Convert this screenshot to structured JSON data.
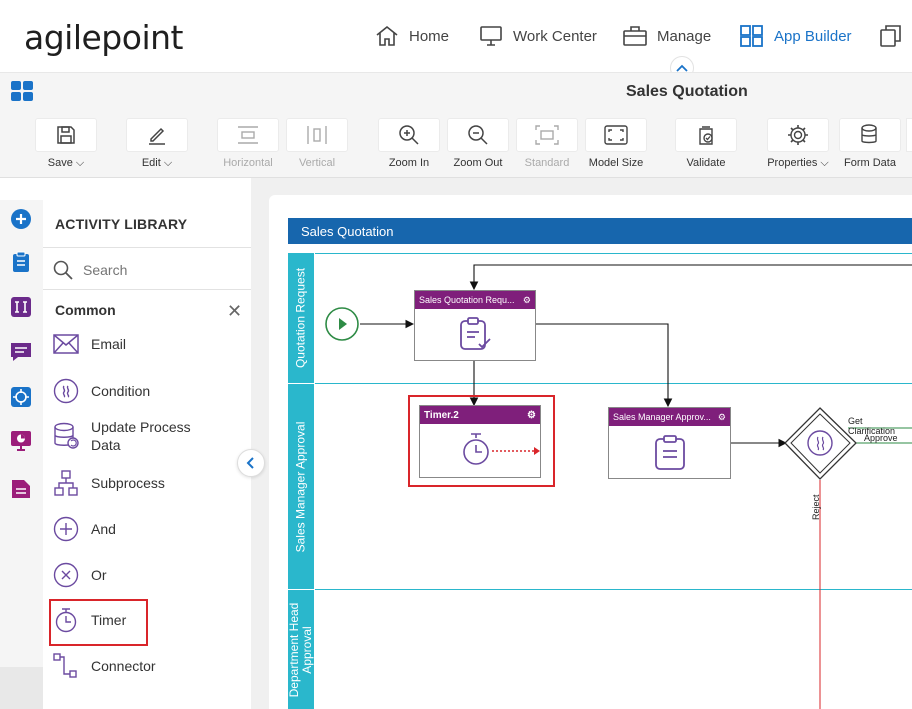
{
  "brand": {
    "logo_text": "agilepoint"
  },
  "nav": {
    "items": [
      {
        "label": "Home",
        "icon": "home-icon"
      },
      {
        "label": "Work Center",
        "icon": "monitor-icon"
      },
      {
        "label": "Manage",
        "icon": "briefcase-icon"
      },
      {
        "label": "App Builder",
        "icon": "grid-icon",
        "active": true
      },
      {
        "label": "",
        "icon": "copy-icon"
      }
    ]
  },
  "title_bar": {
    "title": "Sales Quotation"
  },
  "toolbar": {
    "save": "Save",
    "edit": "Edit",
    "horizontal": "Horizontal",
    "vertical": "Vertical",
    "zoom_in": "Zoom In",
    "zoom_out": "Zoom Out",
    "standard": "Standard",
    "model_size": "Model Size",
    "validate": "Validate",
    "properties": "Properties",
    "form_data": "Form Data"
  },
  "library": {
    "title": "ACTIVITY LIBRARY",
    "search_placeholder": "Search",
    "section": "Common",
    "items": [
      {
        "label": "Email",
        "icon": "email-icon"
      },
      {
        "label": "Condition",
        "icon": "condition-icon"
      },
      {
        "label": "Update Process Data",
        "icon": "database-icon"
      },
      {
        "label": "Subprocess",
        "icon": "subprocess-icon"
      },
      {
        "label": "And",
        "icon": "plus-circle-icon"
      },
      {
        "label": "Or",
        "icon": "x-circle-icon"
      },
      {
        "label": "Timer",
        "icon": "timer-icon"
      },
      {
        "label": "Connector",
        "icon": "connector-icon"
      }
    ]
  },
  "diagram": {
    "pool_title": "Sales Quotation",
    "lanes": [
      "Quotation Request",
      "Sales Manager Approval",
      "Department Head Approval"
    ],
    "tasks": {
      "quotation_request": "Sales Quotation Requ...",
      "timer": "Timer.2",
      "manager_approval": "Sales Manager Approv..."
    },
    "flows": {
      "get_clarification": "Get Clarification",
      "approve": "Approve",
      "reject": "Reject"
    },
    "colors": {
      "pool_header": "#1766ad",
      "lane": "#2ab7cc",
      "task_header": "#7f1f7b",
      "highlight": "#d9252a",
      "start_event": "#2e8b45"
    }
  }
}
